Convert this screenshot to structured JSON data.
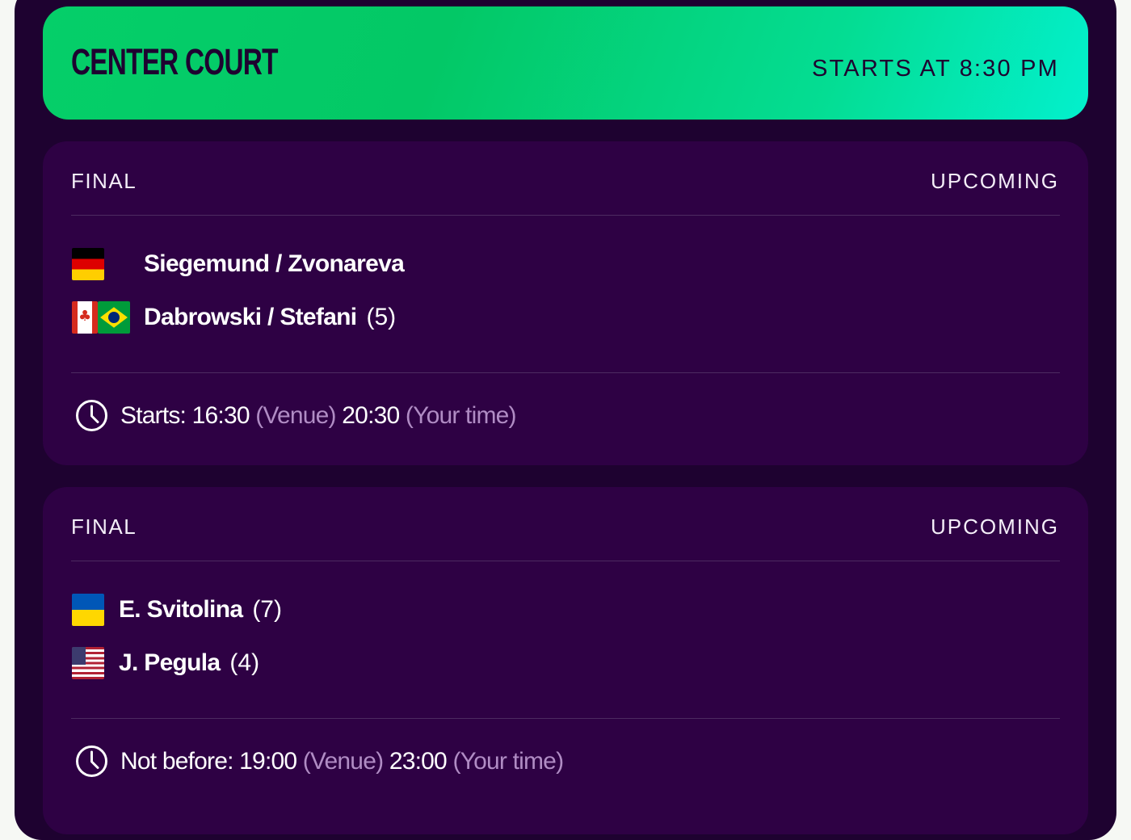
{
  "court": {
    "name": "CENTER COURT",
    "start_text": "STARTS AT 8:30 PM"
  },
  "matches": [
    {
      "round": "FINAL",
      "status": "UPCOMING",
      "players": [
        {
          "flags": [
            "de"
          ],
          "name": "Siegemund / Zvonareva",
          "seed": ""
        },
        {
          "flags": [
            "ca",
            "br"
          ],
          "name": "Dabrowski / Stefani",
          "seed": "(5)"
        }
      ],
      "time": {
        "label": "Starts:",
        "venue_time": "16:30",
        "venue_label": "(Venue)",
        "local_time": "20:30",
        "local_label": "(Your time)"
      }
    },
    {
      "round": "FINAL",
      "status": "UPCOMING",
      "players": [
        {
          "flags": [
            "ua"
          ],
          "name": "E. Svitolina",
          "seed": "(7)"
        },
        {
          "flags": [
            "us"
          ],
          "name": "J. Pegula",
          "seed": "(4)"
        }
      ],
      "time": {
        "label": "Not before:",
        "venue_time": "19:00",
        "venue_label": "(Venue)",
        "local_time": "23:00",
        "local_label": "(Your time)"
      }
    }
  ],
  "icons": {
    "clock": "clock-icon",
    "flags": [
      "flag-germany-icon",
      "flag-canada-icon",
      "flag-brazil-icon",
      "flag-ukraine-icon",
      "flag-usa-icon"
    ]
  },
  "colors": {
    "background": "#1e0230",
    "card": "#2e0144",
    "header_gradient_start": "#05cf69",
    "header_gradient_end": "#03f0cd",
    "muted_text": "#b08cc4"
  }
}
